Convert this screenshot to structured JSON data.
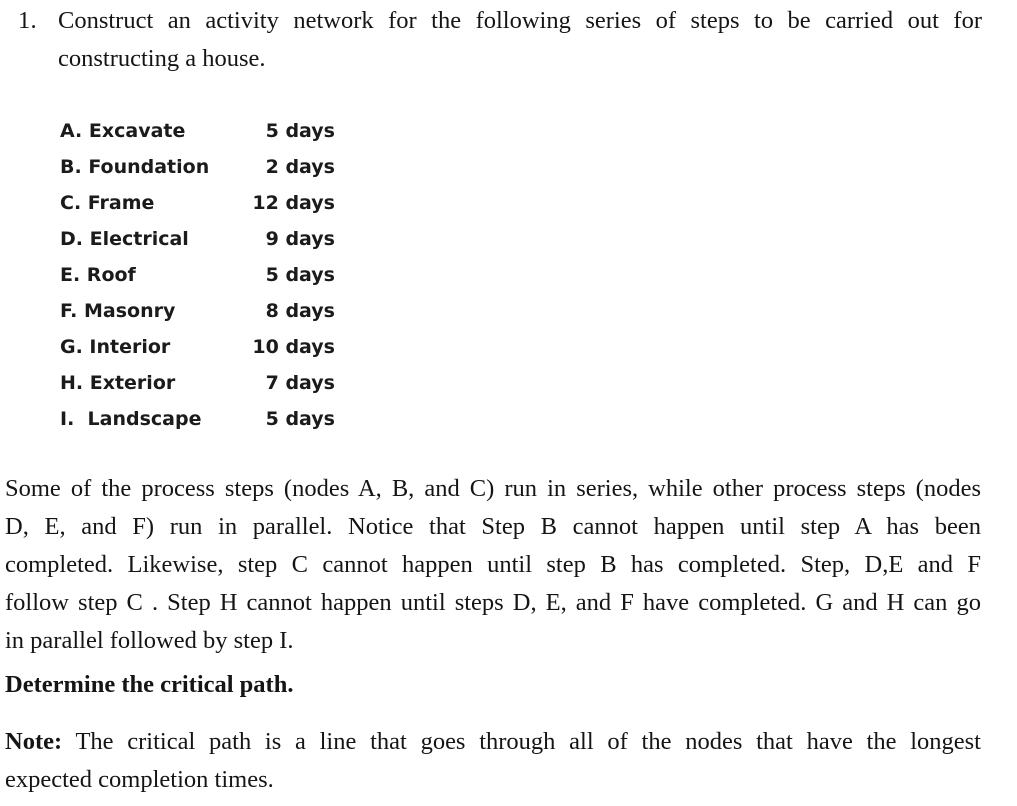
{
  "question": {
    "number": "1.",
    "line_1": "Construct an activity network for the following series of steps to be carried out for",
    "line_2": "constructing a house."
  },
  "activities": {
    "rows": [
      {
        "label": "A. Excavate",
        "duration": "5 days"
      },
      {
        "label": "B. Foundation",
        "duration": "2 days"
      },
      {
        "label": "C. Frame",
        "duration": "12 days"
      },
      {
        "label": "D. Electrical",
        "duration": "9 days"
      },
      {
        "label": "E. Roof",
        "duration": "5 days"
      },
      {
        "label": "F. Masonry",
        "duration": "8 days"
      },
      {
        "label": "G. Interior",
        "duration": "10 days"
      },
      {
        "label": "H. Exterior",
        "duration": "7 days"
      },
      {
        "label": "I.  Landscape",
        "duration": "5 days"
      }
    ]
  },
  "description": {
    "line_1": "Some of the process steps (nodes A, B, and C) run in series, while other process steps (nodes",
    "line_2": "D, E, and F) run in parallel. Notice that Step B cannot happen until step A has been",
    "line_3": "completed. Likewise, step C cannot happen until step B has completed. Step, D,E and F",
    "line_4": "follow step C . Step H cannot happen until steps D, E, and F have completed. G and H can go",
    "line_5": "in parallel followed by step I."
  },
  "prompt": {
    "heading": "Determine the critical path."
  },
  "note": {
    "label": "Note:",
    "line_1": "The critical path is a line that goes through all of the nodes that have the longest",
    "line_2": "expected completion times."
  },
  "colors": {
    "page_background": "#ffffff",
    "body_text": "#151515",
    "list_text": "#1b1b1b"
  }
}
